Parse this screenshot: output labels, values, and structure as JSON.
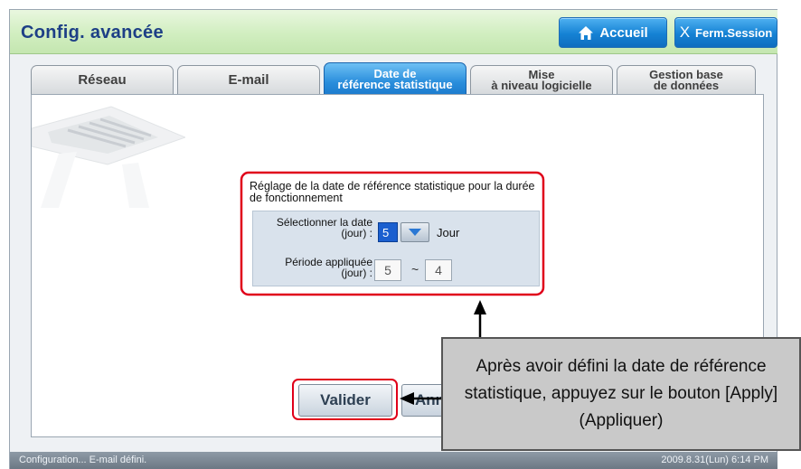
{
  "header": {
    "title": "Config. avancée",
    "home_label": "Accueil",
    "logout_label": "Ferm.Session"
  },
  "tabs": [
    {
      "line1": "Réseau",
      "line2": "",
      "active": false
    },
    {
      "line1": "E-mail",
      "line2": "",
      "active": false
    },
    {
      "line1": "Date de",
      "line2": "référence statistique",
      "active": true
    },
    {
      "line1": "Mise",
      "line2": "à niveau logicielle",
      "active": false
    },
    {
      "line1": "Gestion base",
      "line2": "de données",
      "active": false
    }
  ],
  "panel": {
    "title": "Réglage de la date de référence statistique pour la durée de fonctionnement",
    "date_label_1": "Sélectionner la date",
    "date_label_2": "(jour) :",
    "date_value": "5",
    "unit": "Jour",
    "period_label_1": "Période appliquée",
    "period_label_2": "(jour) :",
    "period_start": "5",
    "period_separator": "~",
    "period_end": "4"
  },
  "actions": {
    "validate_label": "Valider",
    "cancel_label": "Ann"
  },
  "callout": {
    "text": "Après avoir défini la date de référence statistique, appuyez sur le bouton [Apply] (Appliquer)"
  },
  "status": {
    "message": "Configuration... E-mail défini.",
    "datetime": "2009.8.31(Lun)  6:14 PM"
  },
  "colors": {
    "accent": "#1582d4",
    "title": "#1d3f86",
    "highlight": "#e0001a"
  },
  "icons": {
    "home": "house-icon",
    "logout": "x-icon",
    "dropdown": "chevron-down-icon"
  }
}
